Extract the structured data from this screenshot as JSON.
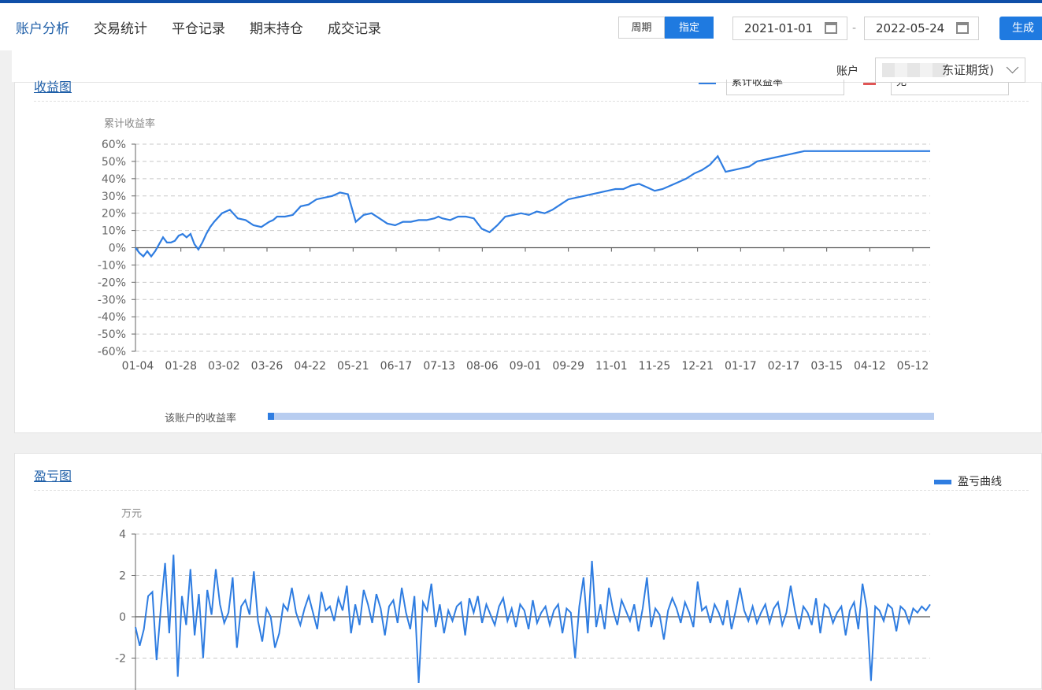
{
  "nav": {
    "tabs": [
      "账户分析",
      "交易统计",
      "平仓记录",
      "期末持仓",
      "成交记录"
    ],
    "active": 0
  },
  "period": {
    "options": [
      "周期",
      "指定"
    ],
    "selected": "指定"
  },
  "dates": {
    "start": "2021-01-01",
    "separator": "-",
    "end": "2022-05-24"
  },
  "generate_label": "生成",
  "account": {
    "label": "账户",
    "value": "东证期货)"
  },
  "returns_panel": {
    "title": "收益图",
    "metric_select": "累计收益率",
    "compare_select": "无",
    "series_color": "#2f7de1",
    "compare_color": "#e05555",
    "slider_label": "该账户的收益率"
  },
  "pnl_panel": {
    "title": "盈亏图",
    "legend": "盈亏曲线"
  },
  "chart_data": [
    {
      "type": "line",
      "ylabel": "累计收益率",
      "ylim": [
        -60,
        60
      ],
      "yticks": [
        "60%",
        "50%",
        "40%",
        "30%",
        "20%",
        "10%",
        "0%",
        "-10%",
        "-20%",
        "-30%",
        "-40%",
        "-50%",
        "-60%"
      ],
      "x_tick_labels": [
        "01-04",
        "01-28",
        "03-02",
        "03-26",
        "04-22",
        "05-21",
        "06-17",
        "07-13",
        "08-06",
        "09-01",
        "09-29",
        "11-01",
        "11-25",
        "12-21",
        "01-17",
        "02-17",
        "03-15",
        "04-12",
        "05-12"
      ],
      "grid": true,
      "x": [
        0,
        5,
        10,
        15,
        20,
        25,
        30,
        35,
        40,
        45,
        50,
        55,
        60,
        65,
        70,
        75,
        80,
        85,
        90,
        95,
        100,
        110,
        120,
        130,
        140,
        150,
        160,
        170,
        175,
        180,
        190,
        200,
        210,
        220,
        230,
        240,
        250,
        255,
        260,
        270,
        280,
        290,
        300,
        310,
        320,
        330,
        340,
        350,
        360,
        370,
        380,
        385,
        390,
        400,
        410,
        420,
        430,
        440,
        450,
        460,
        470,
        480,
        490,
        500,
        510,
        520,
        530,
        540,
        550,
        560,
        570,
        580,
        590,
        600,
        610,
        620,
        630,
        640,
        650,
        660,
        670,
        680,
        690,
        700,
        710,
        720,
        730,
        740,
        750,
        760,
        770,
        780,
        790,
        800,
        810,
        820,
        830,
        840,
        850,
        860,
        870,
        880,
        890,
        900,
        910,
        915,
        920,
        930,
        940,
        950,
        960,
        970,
        980,
        990,
        1000,
        1010
      ],
      "series": [
        {
          "name": "累计收益率",
          "values": [
            0,
            -3,
            -5,
            -2,
            -5,
            -2,
            2,
            6,
            3,
            3,
            4,
            7,
            8,
            6,
            8,
            2,
            -1,
            3,
            8,
            12,
            15,
            20,
            22,
            17,
            16,
            13,
            12,
            15,
            16,
            18,
            18,
            19,
            24,
            25,
            28,
            29,
            30,
            31,
            32,
            31,
            15,
            19,
            20,
            17,
            14,
            13,
            15,
            15,
            16,
            16,
            17,
            18,
            17,
            16,
            18,
            18,
            17,
            11,
            9,
            13,
            18,
            19,
            20,
            19,
            21,
            20,
            22,
            25,
            28,
            29,
            30,
            31,
            32,
            33,
            34,
            34,
            36,
            37,
            35,
            33,
            34,
            36,
            38,
            40,
            43,
            45,
            48,
            53,
            44,
            45,
            46,
            47,
            50,
            51,
            52,
            53,
            54,
            55,
            56,
            56,
            56,
            56,
            56,
            56,
            56,
            56,
            56,
            56,
            56,
            56,
            56,
            56,
            56,
            56,
            56,
            56
          ]
        }
      ]
    },
    {
      "type": "line",
      "ylabel": "万元",
      "ylim": [
        -3.2,
        4
      ],
      "yticks": [
        "4",
        "2",
        "0",
        "-2"
      ],
      "grid": true,
      "series": [
        {
          "name": "盈亏曲线",
          "values": [
            -0.5,
            -1.4,
            -0.6,
            1.0,
            1.2,
            -2.1,
            0.4,
            2.6,
            -0.8,
            3.0,
            -2.9,
            1.0,
            -0.4,
            2.3,
            -0.9,
            1.1,
            -2.0,
            1.3,
            0.1,
            2.3,
            0.6,
            -0.3,
            0.2,
            1.9,
            -1.5,
            0.5,
            0.8,
            0.1,
            2.2,
            -0.2,
            -1.2,
            0.4,
            0.0,
            -1.5,
            -0.8,
            0.6,
            0.3,
            1.4,
            0.2,
            -0.4,
            0.4,
            1.0,
            0.2,
            -0.6,
            1.2,
            0.3,
            0.5,
            -0.2,
            0.9,
            0.3,
            1.5,
            -0.8,
            0.6,
            -0.4,
            1.3,
            0.6,
            -0.3,
            1.1,
            0.4,
            -0.9,
            0.5,
            0.8,
            -0.3,
            1.4,
            0.2,
            -0.6,
            1.0,
            -3.2,
            0.7,
            0.3,
            1.6,
            -0.5,
            0.6,
            -0.8,
            0.3,
            -0.2,
            0.5,
            0.7,
            -0.9,
            0.9,
            0.2,
            1.0,
            -0.3,
            0.6,
            0.1,
            -0.4,
            0.5,
            0.9,
            -0.2,
            0.4,
            -0.5,
            0.6,
            0.3,
            -0.6,
            0.8,
            -0.3,
            0.2,
            0.5,
            -0.4,
            0.3,
            0.6,
            -0.8,
            0.4,
            0.2,
            -2.0,
            0.5,
            1.9,
            -0.8,
            2.7,
            -0.5,
            0.6,
            -0.6,
            1.4,
            0.3,
            -0.4,
            0.8,
            0.3,
            -0.2,
            0.6,
            -0.7,
            0.4,
            1.9,
            -0.5,
            0.4,
            0.1,
            -1.1,
            0.3,
            0.9,
            0.4,
            -0.3,
            0.7,
            0.2,
            -0.5,
            1.7,
            0.3,
            0.5,
            -0.3,
            0.6,
            0.2,
            -0.4,
            0.8,
            -0.6,
            0.3,
            1.4,
            0.3,
            -0.2,
            0.5,
            -0.3,
            0.2,
            0.6,
            -0.3,
            0.4,
            0.7,
            -0.4,
            0.2,
            1.5,
            0.3,
            -0.6,
            0.5,
            0.2,
            -0.4,
            0.9,
            -0.8,
            0.6,
            0.4,
            -0.3,
            0.2,
            0.5,
            -0.9,
            0.3,
            0.7,
            -0.6,
            1.6,
            0.4,
            -3.1,
            0.5,
            0.3,
            -0.2,
            0.6,
            0.4,
            -0.7,
            0.5,
            0.3,
            -0.3,
            0.4,
            0.2,
            0.5,
            0.3,
            0.6
          ]
        }
      ]
    }
  ]
}
